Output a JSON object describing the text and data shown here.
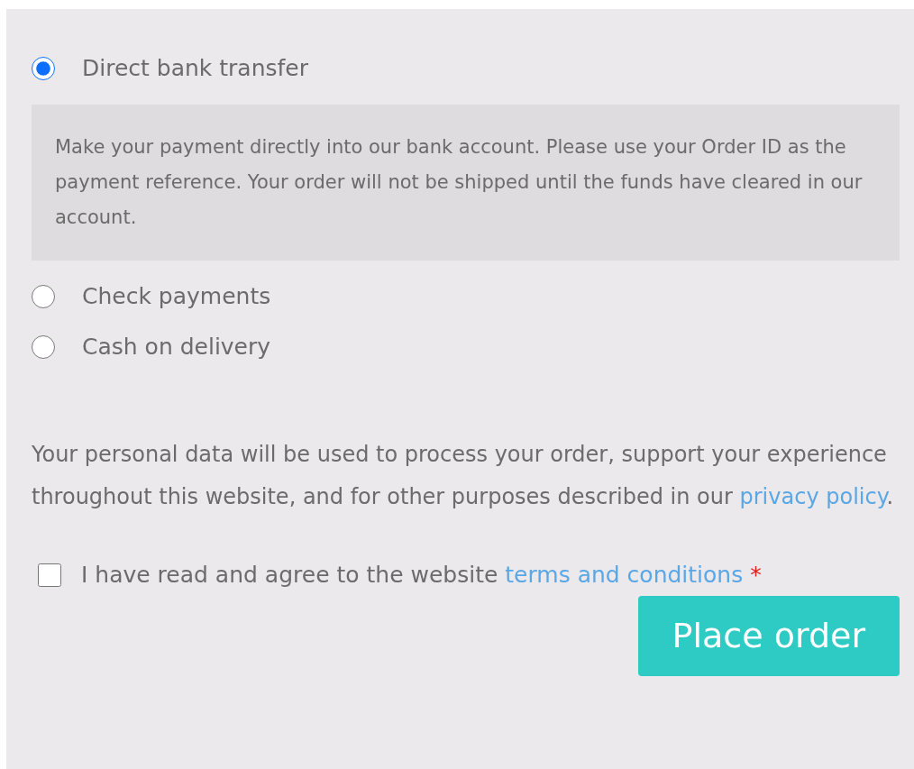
{
  "payment_methods": [
    {
      "label": "Direct bank transfer",
      "selected": true,
      "description": "Make your payment directly into our bank account. Please use your Order ID as the payment reference. Your order will not be shipped until the funds have cleared in our account."
    },
    {
      "label": "Check payments",
      "selected": false
    },
    {
      "label": "Cash on delivery",
      "selected": false
    }
  ],
  "privacy_notice": {
    "text_before": "Your personal data will be used to process your order, support your experience throughout this website, and for other purposes described in our",
    "link": "privacy policy",
    "text_after": "."
  },
  "terms": {
    "checked": false,
    "text": "I have read and agree to the website",
    "link": "terms and conditions",
    "required_mark": "*"
  },
  "place_order_button": "Place order"
}
